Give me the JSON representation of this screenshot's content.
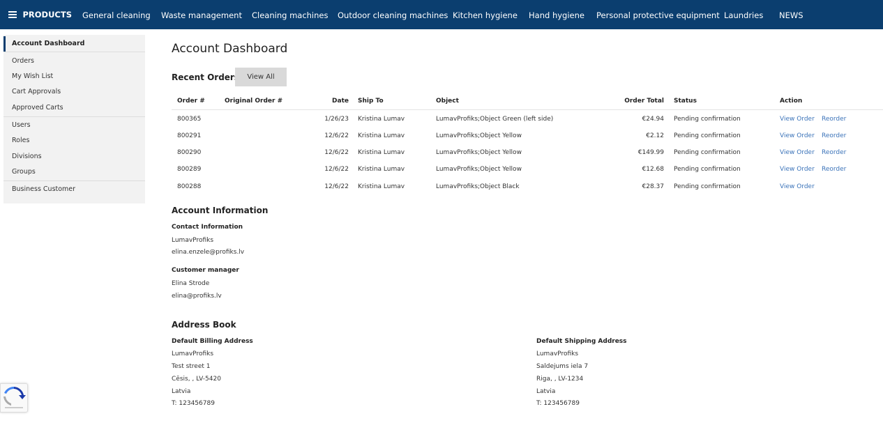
{
  "nav": {
    "products_label": "PRODUCTS",
    "items": [
      "General cleaning",
      "Waste management",
      "Cleaning machines",
      "Outdoor cleaning machines",
      "Kitchen hygiene",
      "Hand hygiene",
      "Personal protective equipment",
      "Laundries",
      "NEWS"
    ]
  },
  "sidebar": {
    "active": "Account Dashboard",
    "items": [
      "Orders",
      "My Wish List",
      "Cart Approvals",
      "Approved Carts",
      "Users",
      "Roles",
      "Divisions",
      "Groups",
      "Business Customer"
    ]
  },
  "main": {
    "title": "Account Dashboard",
    "recent_orders": {
      "title": "Recent Orders",
      "view_all": "View All",
      "columns": [
        "Order #",
        "Original Order #",
        "Date",
        "Ship To",
        "Object",
        "Order Total",
        "Status",
        "Action"
      ],
      "rows": [
        {
          "order": "800365",
          "original": "",
          "date": "1/26/23",
          "ship_to": "Kristina Lumav",
          "object": "LumavProfiks;Object Green (left side)",
          "total": "€24.94",
          "status": "Pending confirmation",
          "view": "View Order",
          "reorder": "Reorder"
        },
        {
          "order": "800291",
          "original": "",
          "date": "12/6/22",
          "ship_to": "Kristina Lumav",
          "object": "LumavProfiks;Object Yellow",
          "total": "€2.12",
          "status": "Pending confirmation",
          "view": "View Order",
          "reorder": "Reorder"
        },
        {
          "order": "800290",
          "original": "",
          "date": "12/6/22",
          "ship_to": "Kristina Lumav",
          "object": "LumavProfiks;Object Yellow",
          "total": "€149.99",
          "status": "Pending confirmation",
          "view": "View Order",
          "reorder": "Reorder"
        },
        {
          "order": "800289",
          "original": "",
          "date": "12/6/22",
          "ship_to": "Kristina Lumav",
          "object": "LumavProfiks;Object Yellow",
          "total": "€12.68",
          "status": "Pending confirmation",
          "view": "View Order",
          "reorder": "Reorder"
        },
        {
          "order": "800288",
          "original": "",
          "date": "12/6/22",
          "ship_to": "Kristina Lumav",
          "object": "LumavProfiks;Object Black",
          "total": "€28.37",
          "status": "Pending confirmation",
          "view": "View Order",
          "reorder": ""
        }
      ]
    },
    "account_info": {
      "title": "Account Information",
      "contact_title": "Contact Information",
      "contact_name": "LumavProfiks",
      "contact_email": "elina.enzele@profiks.lv",
      "manager_title": "Customer manager",
      "manager_name": "Elina Strode",
      "manager_email": "elina@profiks.lv"
    },
    "address_book": {
      "title": "Address Book",
      "billing": {
        "title": "Default Billing Address",
        "name": "LumavProfiks",
        "street": "Test street 1",
        "city": "Cēsis, , LV-5420",
        "country": "Latvia",
        "phone_prefix": "T: ",
        "phone": "123456789"
      },
      "shipping": {
        "title": "Default Shipping Address",
        "name": "LumavProfiks",
        "street": "Saldejums iela 7",
        "city": "Riga, , LV-1234",
        "country": "Latvia",
        "phone_prefix": "T: ",
        "phone": "123456789"
      }
    }
  },
  "colors": {
    "nav_bg": "#0b3e6f",
    "link": "#3b73b9",
    "sidebar_bg": "#f2f2f2"
  }
}
